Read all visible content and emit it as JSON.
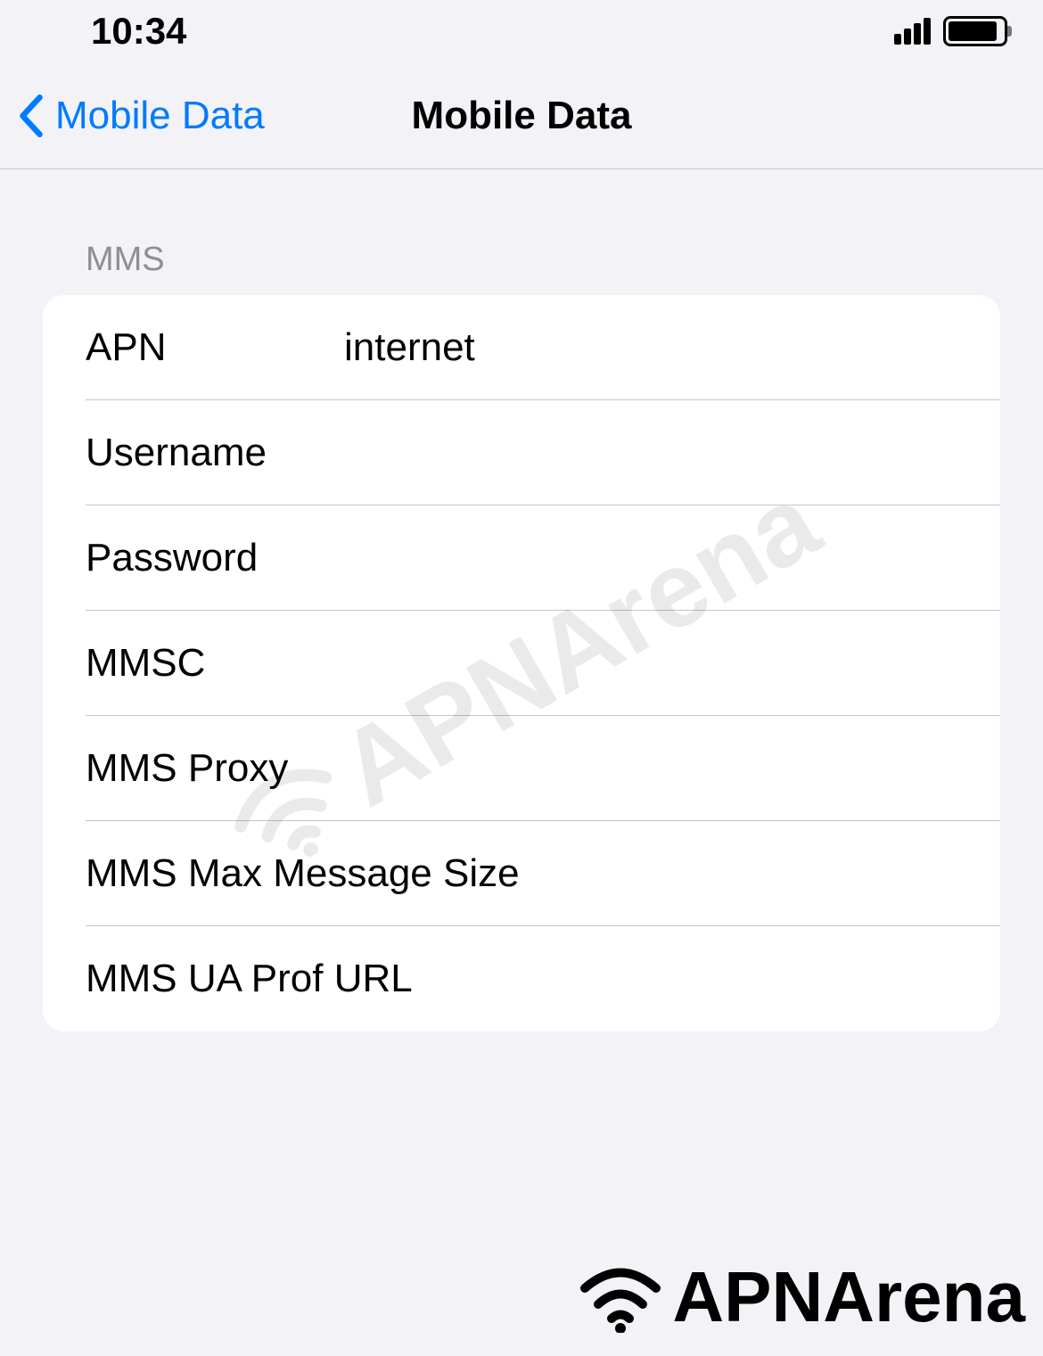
{
  "status_bar": {
    "time": "10:34"
  },
  "nav": {
    "back_label": "Mobile Data",
    "title": "Mobile Data"
  },
  "section": {
    "header": "MMS",
    "rows": [
      {
        "label": "APN",
        "value": "internet",
        "wide": false
      },
      {
        "label": "Username",
        "value": "",
        "wide": false
      },
      {
        "label": "Password",
        "value": "",
        "wide": false
      },
      {
        "label": "MMSC",
        "value": "",
        "wide": false
      },
      {
        "label": "MMS Proxy",
        "value": "",
        "wide": false
      },
      {
        "label": "MMS Max Message Size",
        "value": "",
        "wide": true
      },
      {
        "label": "MMS UA Prof URL",
        "value": "",
        "wide": true
      }
    ]
  },
  "watermark": {
    "text": "APNArena"
  }
}
